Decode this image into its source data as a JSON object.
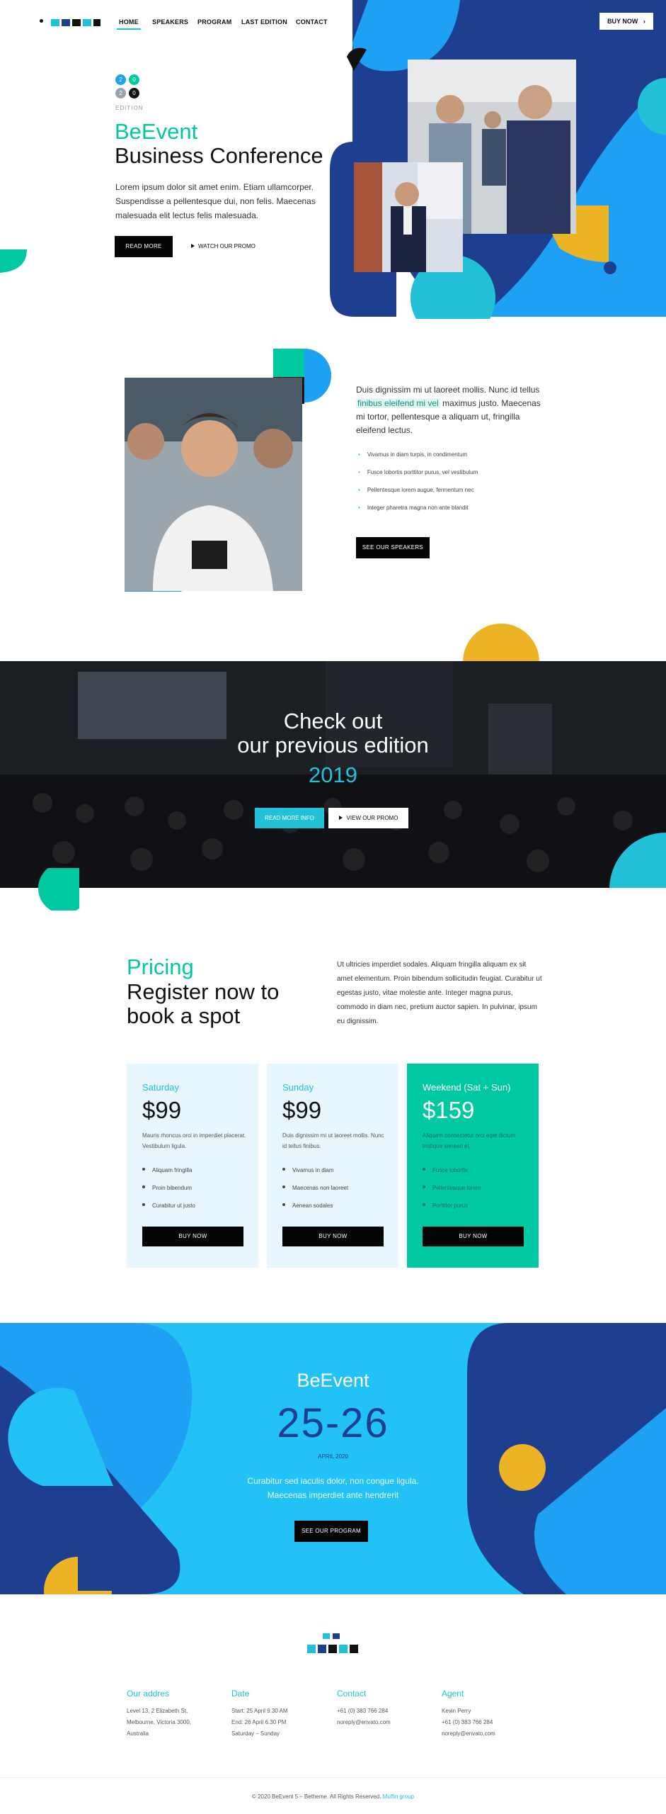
{
  "nav": {
    "items": [
      "HOME",
      "SPEAKERS",
      "PROGRAM",
      "LAST EDITION",
      "CONTACT"
    ],
    "buy_label": "BUY NOW"
  },
  "hero": {
    "badge_digits": [
      "2",
      "0",
      "2",
      "0"
    ],
    "badge_label": "EDITION",
    "title_accent": "BeEvent",
    "title": "Business Conference",
    "text": "Lorem ipsum dolor sit amet enim. Etiam ullamcorper. Suspendisse a pellentesque dui, non felis. Maecenas malesuada elit lectus felis malesuada.",
    "read_more": "READ MORE",
    "watch_promo": "WATCH OUR PROMO"
  },
  "about": {
    "text_before": "Duis dignissim mi ut laoreet mollis. Nunc id tellus ",
    "text_highlight": "finibus eleifend mi vel",
    "text_after": " maximus justo. Maecenas mi tortor, pellentesque a aliquam ut, fringilla eleifend lectus.",
    "checklist": [
      "Vivamus in diam turpis, in condimentum",
      "Fusce lobortis porttitor purus, vel vestibulum",
      "Pellentesque lorem augue, fermentum nec",
      "Integer pharetra magna non ante blandit"
    ],
    "button": "SEE OUR SPEAKERS"
  },
  "previous": {
    "line1": "Check out",
    "line2": "our previous edition",
    "year": "2019",
    "read_more": "READ MORE INFO",
    "view_promo": "VIEW OUR PROMO"
  },
  "pricing": {
    "accent": "Pricing",
    "title_line1": "Register now to",
    "title_line2": "book a spot",
    "text": "Ut ultricies imperdiet sodales. Aliquam fringilla aliquam ex sit amet elementum. Proin bibendum sollicitudin feugiat. Curabitur ut egestas justo, vitae molestie ante. Integer magna purus, commodo in diam nec, pretium auctor sapien. In pulvinar, ipsum eu dignissim.",
    "cards": [
      {
        "day": "Saturday",
        "price": "$99",
        "desc": "Mauris rhoncus orci in imperdiet placerat. Vestibulum ligula.",
        "features": [
          "Aliquam fringilla",
          "Proin bibendum",
          "Curabitur ut justo"
        ],
        "button": "BUY NOW"
      },
      {
        "day": "Sunday",
        "price": "$99",
        "desc": "Duis dignissim mi ut laoreet mollis. Nunc id tellus finibus.",
        "features": [
          "Vivamus in diam",
          "Maecenas non laoreet",
          "Aenean sodales"
        ],
        "button": "BUY NOW"
      },
      {
        "day": "Weekend (Sat + Sun)",
        "price": "$159",
        "desc": "Aliquam consectetur orci eget dictum tristique aenean et.",
        "features": [
          "Fusce lobortis",
          "Pellentesque lorem",
          "Porttitor purus"
        ],
        "button": "BUY NOW"
      }
    ]
  },
  "event": {
    "name": "BeEvent",
    "dates": "25-26",
    "month": "APRIL 2020",
    "text_line1": "Curabitur sed iaculis dolor, non congue ligula.",
    "text_line2": "Maecenas imperdiet ante hendrerit",
    "button": "SEE OUR PROGRAM"
  },
  "footer": {
    "columns": [
      {
        "title": "Our addres",
        "lines": [
          "Level 13, 2 Elizabeth St,",
          "Melbourne, Victoria 3000,",
          "Australia"
        ]
      },
      {
        "title": "Date",
        "lines": [
          "Start: 25 April 9.30 AM",
          "End: 26 April 6.30 PM",
          "Saturday – Sunday"
        ]
      },
      {
        "title": "Contact",
        "lines": [
          "+61 (0) 383 766 284",
          "noreply@envato.com"
        ]
      },
      {
        "title": "Agent",
        "lines": [
          "Kevin Perry",
          "+61 (0) 383 766 284",
          "noreply@envato.com"
        ]
      }
    ],
    "copyright": "© 2020 BeEvent 5 – Betheme. All Rights Reserved.",
    "credit": "Muffin group"
  },
  "colors": {
    "primary_blue": "#1ea0f5",
    "navy": "#1e3f8f",
    "cyan": "#22c1d7",
    "teal": "#00c9a2",
    "yellow": "#ecb424"
  }
}
